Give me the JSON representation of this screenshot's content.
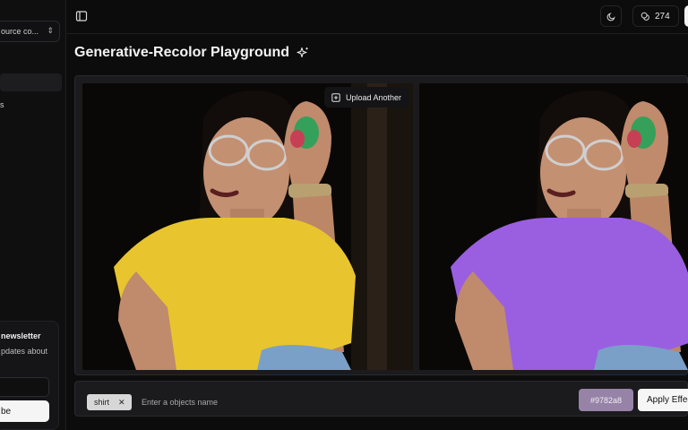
{
  "sidebar": {
    "project_select": "ource co...",
    "nav_item_label": "s",
    "newsletter": {
      "title": "newsletter",
      "description": "pdates about",
      "subscribe_label": "be"
    }
  },
  "header": {
    "credits": "274"
  },
  "main": {
    "title": "Generative-Recolor Playground",
    "upload_label": "Upload Another",
    "object_chip": "shirt",
    "object_placeholder": "Enter a objects name",
    "color_value": "#9782a8",
    "apply_label": "Apply Effect"
  },
  "colors": {
    "original_shirt": "#e8c52e",
    "recolored_shirt": "#9782a8",
    "accent": "#9782a8"
  },
  "icons": {
    "sidebar_toggle": "panel-left-icon",
    "theme": "moon-icon",
    "credits": "coins-icon",
    "title": "sparkles-icon",
    "upload": "image-plus-icon",
    "chip_remove": "x-icon",
    "select": "chevrons-up-down-icon"
  }
}
